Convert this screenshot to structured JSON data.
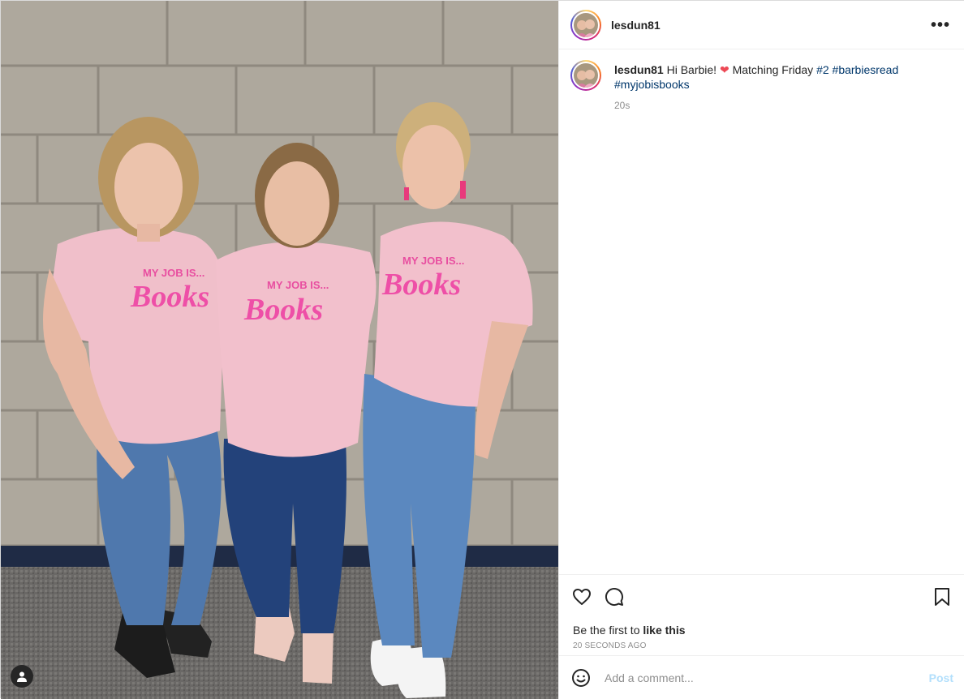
{
  "post": {
    "username": "lesdun81",
    "caption": {
      "username": "lesdun81",
      "text_start": "Hi Barbie!",
      "heart": "❤",
      "text_mid": "Matching Friday",
      "tags": [
        "#2",
        "#barbiesread",
        "#myjobisbooks"
      ]
    },
    "comment_time": "20s",
    "likes_prefix": "Be the first to",
    "likes_link": "like this",
    "post_date": "20 SECONDS AGO",
    "comment_placeholder": "Add a comment...",
    "post_button": "Post",
    "shirt_line1": "MY JOB IS...",
    "shirt_line2": "Books"
  },
  "icons": {
    "more": "more-options-icon",
    "like": "heart-outline-icon",
    "comment": "comment-bubble-icon",
    "save": "bookmark-icon",
    "emoji": "emoji-smile-icon",
    "user_tag": "user-tag-icon"
  },
  "colors": {
    "hashtag": "#00376b",
    "post_button_disabled": "#b2dffc",
    "heart": "#ed4956",
    "muted": "#8e8e8e"
  }
}
